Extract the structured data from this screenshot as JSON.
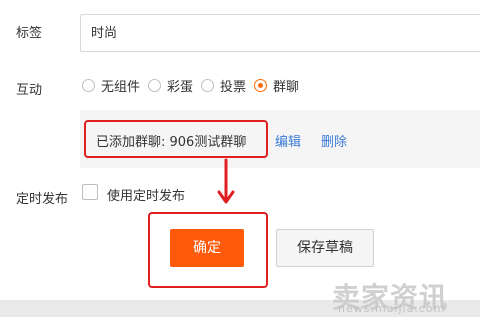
{
  "form": {
    "tag_label": "标签",
    "tag_value": "时尚",
    "interaction_label": "互动",
    "interaction_options": [
      {
        "label": "无组件",
        "selected": false
      },
      {
        "label": "彩蛋",
        "selected": false
      },
      {
        "label": "投票",
        "selected": false
      },
      {
        "label": "群聊",
        "selected": true
      }
    ],
    "group_added_text": "已添加群聊: 906测试群聊",
    "edit_label": "编辑",
    "delete_label": "删除",
    "schedule_label": "定时发布",
    "use_schedule_label": "使用定时发布",
    "use_schedule_checked": false
  },
  "actions": {
    "confirm_label": "确定",
    "save_draft_label": "保存草稿"
  },
  "watermark": {
    "main": "卖家资讯",
    "sub": "news.maijia.com"
  },
  "colors": {
    "accent": "#ff5a0a",
    "annotation_red": "#e02020",
    "link": "#3b7bd6"
  }
}
